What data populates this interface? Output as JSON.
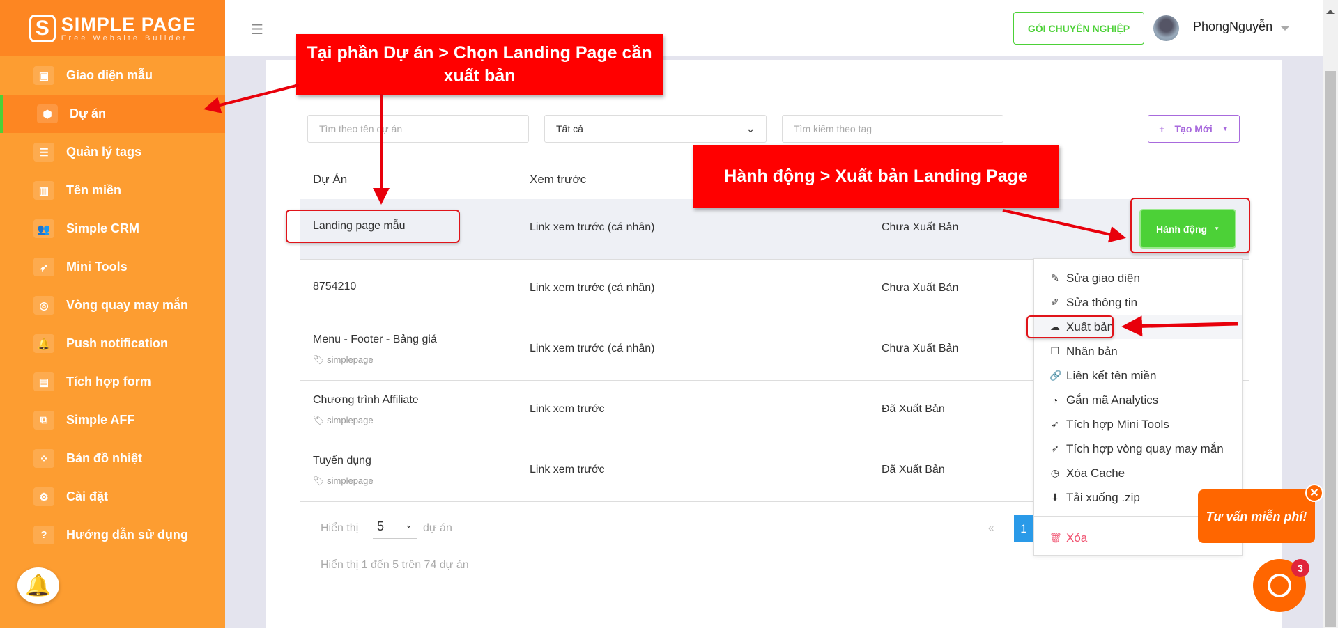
{
  "logo": {
    "title": "SIMPLE PAGE",
    "subtitle": "Free Website Builder"
  },
  "sidebar": {
    "items": [
      {
        "label": "Giao diện mẫu",
        "icon": "template-icon"
      },
      {
        "label": "Dự án",
        "icon": "cube-icon",
        "active": true
      },
      {
        "label": "Quản lý tags",
        "icon": "list-icon"
      },
      {
        "label": "Tên miền",
        "icon": "bar-chart-icon"
      },
      {
        "label": "Simple CRM",
        "icon": "users-icon"
      },
      {
        "label": "Mini Tools",
        "icon": "rocket-icon"
      },
      {
        "label": "Vòng quay may mắn",
        "icon": "wheel-icon"
      },
      {
        "label": "Push notification",
        "icon": "bell-icon"
      },
      {
        "label": "Tích hợp form",
        "icon": "form-icon"
      },
      {
        "label": "Simple AFF",
        "icon": "aff-icon"
      },
      {
        "label": "Bản đồ nhiệt",
        "icon": "heatmap-icon"
      },
      {
        "label": "Cài đặt",
        "icon": "gear-icon"
      },
      {
        "label": "Hướng dẫn sử dụng",
        "icon": "help-icon"
      }
    ]
  },
  "header": {
    "pro_button": "GÓI CHUYÊN NGHIỆP",
    "user_name": "PhongNguyễn"
  },
  "filters": {
    "name_placeholder": "Tìm theo tên dự án",
    "status_select": "Tất cả",
    "tag_placeholder": "Tìm kiếm theo tag",
    "new_button": "Tạo Mới"
  },
  "table": {
    "headers": [
      "Dự Án",
      "Xem trước"
    ],
    "rows": [
      {
        "name": "Landing page mẫu",
        "tag": "",
        "preview": "Link xem trước (cá nhân)",
        "status": "Chưa Xuất Bản"
      },
      {
        "name": "8754210",
        "tag": "",
        "preview": "Link xem trước (cá nhân)",
        "status": "Chưa Xuất Bản"
      },
      {
        "name": "Menu - Footer - Bảng giá",
        "tag": "simplepage",
        "preview": "Link xem trước (cá nhân)",
        "status": "Chưa Xuất Bản"
      },
      {
        "name": "Chương trình Affiliate",
        "tag": "simplepage",
        "preview": "Link xem trước",
        "status": "Đã Xuất Bản"
      },
      {
        "name": "Tuyển dụng",
        "tag": "simplepage",
        "preview": "Link xem trước",
        "status": "Đã Xuất Bản"
      }
    ]
  },
  "action_button": "Hành động",
  "action_menu": [
    {
      "label": "Sửa giao diện",
      "icon": "edit-layout-icon"
    },
    {
      "label": "Sửa thông tin",
      "icon": "edit-info-icon"
    },
    {
      "label": "Xuất bản",
      "icon": "cloud-upload-icon"
    },
    {
      "label": "Nhân bản",
      "icon": "clone-icon"
    },
    {
      "label": "Liên kết tên miền",
      "icon": "link-icon"
    },
    {
      "label": "Gắn mã Analytics",
      "icon": "analytics-icon"
    },
    {
      "label": "Tích hợp Mini Tools",
      "icon": "rocket-icon"
    },
    {
      "label": "Tích hợp vòng quay may mắn",
      "icon": "rocket-icon"
    },
    {
      "label": "Xóa Cache",
      "icon": "clock-icon"
    },
    {
      "label": "Tải xuống .zip",
      "icon": "download-icon"
    }
  ],
  "action_delete": "Xóa",
  "pagination": {
    "show_label": "Hiển thị",
    "per_page": "5",
    "unit": "dự án",
    "info": "Hiển thị 1 đến 5 trên 74 dự án",
    "prev": "«",
    "current": "1"
  },
  "annotations": {
    "callout1": "Tại phần Dự án > Chọn Landing Page cần xuất bản",
    "callout2": "Hành động > Xuất bản Landing Page"
  },
  "chat": {
    "bubble": "Tư vấn miễn phí!",
    "badge": "3"
  },
  "colors": {
    "sidebar": "#fd9d31",
    "sidebar_active": "#fd8622",
    "green": "#4cd137",
    "purple": "#a86add",
    "annotation": "#ff0000",
    "chat": "#ff6600"
  }
}
